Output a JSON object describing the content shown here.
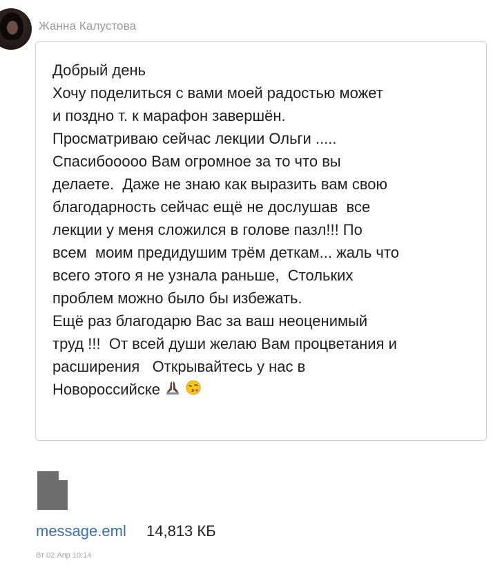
{
  "sender": {
    "name": "Жанна Калустова"
  },
  "message": {
    "lines": [
      "Добрый день",
      "Хочу поделиться с вами моей радостью может",
      "и поздно т. к марафон завершён.",
      "Просматриваю сейчас лекции Ольги .....",
      "Спасибооооо Вам огромное за то что вы",
      "делаете.  Даже не знаю как выразить вам свою",
      "благодарность сейчас ещё не дослушав  все",
      "лекции у меня сложился в голове пазл!!! По",
      "всем  моим предидушим трём деткам... жаль что",
      "всего этого я не узнала раньше,  Стольких",
      "проблем можно было бы избежать.",
      "Ещё раз благодарю Вас за ваш неоценимый",
      "труд !!!  От всей души желаю Вам процветания и",
      "расширения   Открывайтесь у нас в",
      "Новороссийске"
    ],
    "emojis": [
      "praying-hands",
      "face-blowing-kiss"
    ]
  },
  "attachment": {
    "icon": "file-icon",
    "filename": "message.eml",
    "size": "14,813 КБ"
  },
  "timestamp": "Вт 02 Апр 10:14",
  "colors": {
    "link": "#3c6fb5",
    "sender": "#9a9a9a",
    "border": "#cfcfcf",
    "timestamp": "#a8a8a8"
  }
}
